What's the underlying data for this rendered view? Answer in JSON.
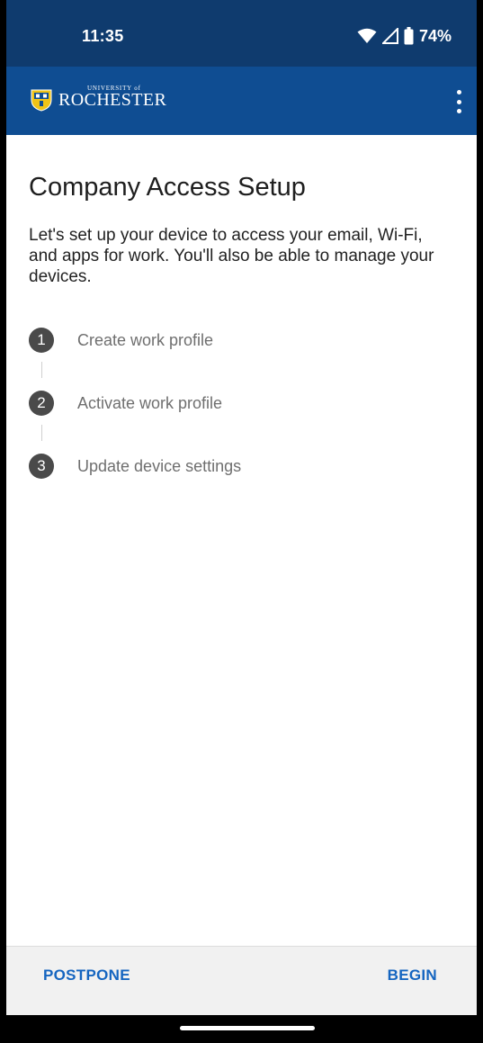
{
  "status_bar": {
    "time": "11:35",
    "battery": "74%",
    "icons": [
      "wifi-icon",
      "signal-icon",
      "battery-icon"
    ]
  },
  "app_bar": {
    "logo_small": "UNIVERSITY of",
    "logo_name": "ROCHESTER",
    "menu_icon": "more-vert-icon",
    "color": "#0f4d92"
  },
  "page": {
    "title": "Company Access Setup",
    "description": "Let's set up your device to access your email, Wi-Fi, and apps for work. You'll also be able to manage your devices."
  },
  "steps": [
    {
      "number": "1",
      "label": "Create work profile"
    },
    {
      "number": "2",
      "label": "Activate work profile"
    },
    {
      "number": "3",
      "label": "Update device settings"
    }
  ],
  "actions": {
    "postpone": "POSTPONE",
    "begin": "BEGIN",
    "accent": "#1565c0"
  }
}
